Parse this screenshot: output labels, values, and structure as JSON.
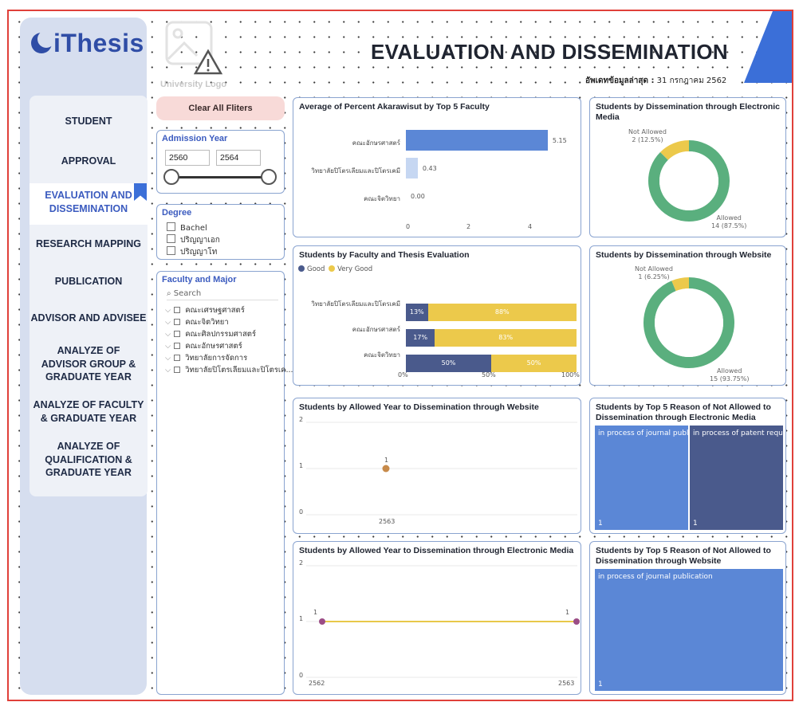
{
  "app": {
    "logo_text": "iThesis",
    "university_logo_label": "University Logo"
  },
  "page": {
    "title": "EVALUATION AND DISSEMINATION",
    "update_label": "อัพเดทข้อมูลล่าสุด :",
    "update_value": "31 กรกฎาคม 2562"
  },
  "nav": {
    "items": [
      {
        "label": "STUDENT"
      },
      {
        "label": "APPROVAL"
      },
      {
        "label": "EVALUATION AND DISSEMINATION"
      },
      {
        "label": "RESEARCH MAPPING"
      },
      {
        "label": "PUBLICATION"
      },
      {
        "label": "ADVISOR AND ADVISEE"
      },
      {
        "label": "ANALYZE OF ADVISOR GROUP & GRADUATE YEAR"
      },
      {
        "label": "ANALYZE OF FACULTY & GRADUATE YEAR"
      },
      {
        "label": "ANALYZE OF QUALIFICATION & GRADUATE YEAR"
      }
    ],
    "active_index": 2
  },
  "filters": {
    "clear_label": "Clear All Fliters",
    "admission_year": {
      "title": "Admission Year",
      "from": "2560",
      "to": "2564"
    },
    "degree": {
      "title": "Degree",
      "options": [
        "Bachel",
        "ปริญญาเอก",
        "ปริญญาโท"
      ]
    },
    "faculty": {
      "title": "Faculty and Major",
      "search_placeholder": "Search",
      "items": [
        "คณะเศรษฐศาสตร์",
        "คณะจิตวิทยา",
        "คณะศิลปกรรมศาสตร์",
        "คณะอักษรศาสตร์",
        "วิทยาลัยการจัดการ",
        "วิทยาลัยปิโตรเลียมและปิโตรเค..."
      ]
    }
  },
  "cards": {
    "akarawisut": {
      "title": "Average of Percent Akarawisut by Top 5 Faculty",
      "value_labels": [
        "5.15",
        "0.43",
        "0.00"
      ],
      "ticks": [
        "0",
        "2",
        "4"
      ]
    },
    "electronic_media": {
      "title": "Students by Dissemination through Electronic Media",
      "not_allowed_label": "Not Allowed",
      "not_allowed_value": "2 (12.5%)",
      "allowed_label": "Allowed",
      "allowed_value": "14 (87.5%)"
    },
    "faculty_eval": {
      "title": "Students by Faculty and Thesis Evaluation",
      "legend": [
        "Good",
        "Very Good"
      ],
      "ticks": [
        "0%",
        "50%",
        "100%"
      ],
      "good_labels": [
        "13%",
        "17%",
        "50%"
      ],
      "verygood_labels": [
        "88%",
        "83%",
        "50%"
      ]
    },
    "website": {
      "title": "Students by Dissemination through Website",
      "not_allowed_label": "Not Allowed",
      "not_allowed_value": "1 (6.25%)",
      "allowed_label": "Allowed",
      "allowed_value": "15 (93.75%)"
    },
    "allowed_year_web": {
      "title": "Students by Allowed Year to Dissemination through Website",
      "y_ticks": [
        "2",
        "1",
        "0"
      ],
      "x_tick": "2563",
      "point_label": "1"
    },
    "reason_em": {
      "title": "Students by Top 5 Reason of Not Allowed to Dissemination through Electronic Media",
      "tiles": [
        {
          "label": "in process of journal publ...",
          "value": "1"
        },
        {
          "label": "in process of patent requ...",
          "value": "1"
        }
      ]
    },
    "allowed_year_em": {
      "title": "Students by Allowed Year to Dissemination through Electronic Media",
      "y_ticks": [
        "2",
        "1",
        "0"
      ],
      "x_ticks": [
        "2562",
        "2563"
      ],
      "point_labels": [
        "1",
        "1"
      ]
    },
    "reason_web": {
      "title": "Students by Top 5 Reason of Not Allowed to Dissemination through Website",
      "tiles": [
        {
          "label": "in process of journal publication",
          "value": "1"
        }
      ]
    }
  },
  "colors": {
    "accent": "#3b6fd8",
    "bar_blue": "#5b87d6",
    "good": "#4a5a8c",
    "very_good": "#ecc94b",
    "allowed": "#5aaf7e",
    "not_allowed": "#ecc94b",
    "point": "#c78a4a",
    "line_yellow": "#e8c84a",
    "point_purple": "#9b4d86"
  },
  "chart_data": [
    {
      "type": "bar",
      "title": "Average of Percent Akarawisut by Top 5 Faculty",
      "categories": [
        "คณะอักษรศาสตร์",
        "วิทยาลัยปิโตรเลียมและปิโตรเคมี",
        "คณะจิตวิทยา"
      ],
      "values": [
        5.15,
        0.43,
        0.0
      ],
      "xlim": [
        0,
        5.5
      ]
    },
    {
      "type": "pie",
      "title": "Students by Dissemination through Electronic Media",
      "categories": [
        "Not Allowed",
        "Allowed"
      ],
      "values": [
        2,
        14
      ]
    },
    {
      "type": "bar",
      "title": "Students by Faculty and Thesis Evaluation",
      "categories": [
        "วิทยาลัยปิโตรเลียมและปิโตรเคมี",
        "คณะอักษรศาสตร์",
        "คณะจิตวิทยา"
      ],
      "series": [
        {
          "name": "Good",
          "values": [
            13,
            17,
            50
          ]
        },
        {
          "name": "Very Good",
          "values": [
            88,
            83,
            50
          ]
        }
      ]
    },
    {
      "type": "pie",
      "title": "Students by Dissemination through Website",
      "categories": [
        "Not Allowed",
        "Allowed"
      ],
      "values": [
        1,
        15
      ]
    },
    {
      "type": "scatter",
      "title": "Students by Allowed Year to Dissemination through Website",
      "x": [
        2563
      ],
      "y": [
        1
      ],
      "ylim": [
        0,
        2
      ]
    },
    {
      "type": "line",
      "title": "Students by Allowed Year to Dissemination through Electronic Media",
      "x": [
        2562,
        2563
      ],
      "y": [
        1,
        1
      ],
      "ylim": [
        0,
        2
      ]
    }
  ],
  "lists": {
    "akarawisut_cats": [
      "คณะอักษรศาสตร์",
      "วิทยาลัยปิโตรเลียมและปิโตรเคมี",
      "คณะจิตวิทยา"
    ],
    "eval_cats": [
      "วิทยาลัยปิโตรเลียมและปิโตรเคมี",
      "คณะอักษรศาสตร์",
      "คณะจิตวิทยา"
    ]
  }
}
